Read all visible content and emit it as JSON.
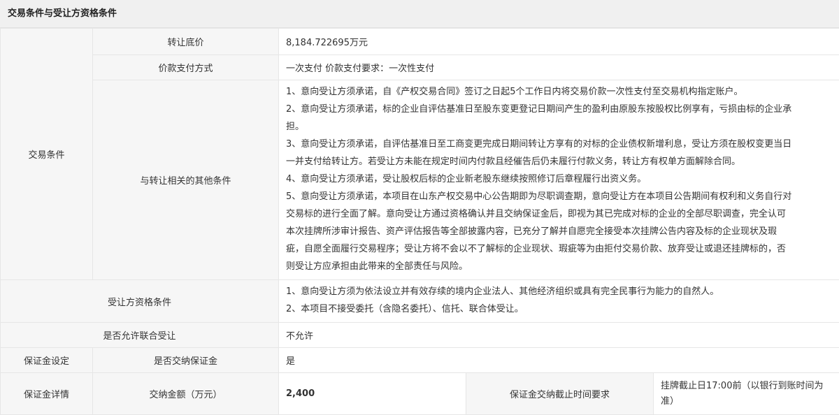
{
  "section_title": "交易条件与受让方资格条件",
  "rows": {
    "transfer_price_label": "转让底价",
    "transfer_price_value": "8,184.722695万元",
    "payment_method_label": "价款支付方式",
    "payment_method_value": "一次支付 价款支付要求：一次性支付",
    "trade_conditions_group": "交易条件",
    "other_conditions_label": "与转让相关的其他条件",
    "other_conditions_lines": [
      "1、意向受让方须承诺，自《产权交易合同》签订之日起5个工作日内将交易价款一次性支付至交易机构指定账户。",
      "2、意向受让方须承诺，标的企业自评估基准日至股东变更登记日期间产生的盈利由原股东按股权比例享有，亏损由标的企业承",
      "担。",
      "3、意向受让方须承诺，自评估基准日至工商变更完成日期间转让方享有的对标的企业债权新增利息，受让方须在股权变更当日",
      "一并支付给转让方。若受让方未能在规定时间内付款且经催告后仍未履行付款义务，转让方有权单方面解除合同。",
      "4、意向受让方须承诺，受让股权后标的企业新老股东继续按照修订后章程履行出资义务。",
      "5、意向受让方须承诺，本项目在山东产权交易中心公告期即为尽职调查期，意向受让方在本项目公告期间有权利和义务自行对",
      "交易标的进行全面了解。意向受让方通过资格确认并且交纳保证金后，即视为其已完成对标的企业的全部尽职调查，完全认可",
      "本次挂牌所涉审计报告、资产评估报告等全部披露内容，已充分了解并自愿完全接受本次挂牌公告内容及标的企业现状及瑕",
      "疵，自愿全面履行交易程序；受让方将不会以不了解标的企业现状、瑕疵等为由拒付交易价款、放弃受让或退还挂牌标的，否",
      "则受让方应承担由此带来的全部责任与风险。"
    ],
    "qualification_label": "受让方资格条件",
    "qualification_lines": [
      "1、意向受让方须为依法设立并有效存续的境内企业法人、其他经济组织或具有完全民事行为能力的自然人。",
      "2、本项目不接受委托（含隐名委托）、信托、联合体受让。"
    ],
    "joint_label": "是否允许联合受让",
    "joint_value": "不允许",
    "deposit_setting_group": "保证金设定",
    "deposit_required_label": "是否交纳保证金",
    "deposit_required_value": "是",
    "deposit_details_group": "保证金详情",
    "deposit_amount_label": "交纳金额（万元）",
    "deposit_amount_value": "2,400",
    "deposit_deadline_label": "保证金交纳截止时间要求",
    "deposit_deadline_value": "挂牌截止日17:00前（以银行到账时间为准）"
  }
}
